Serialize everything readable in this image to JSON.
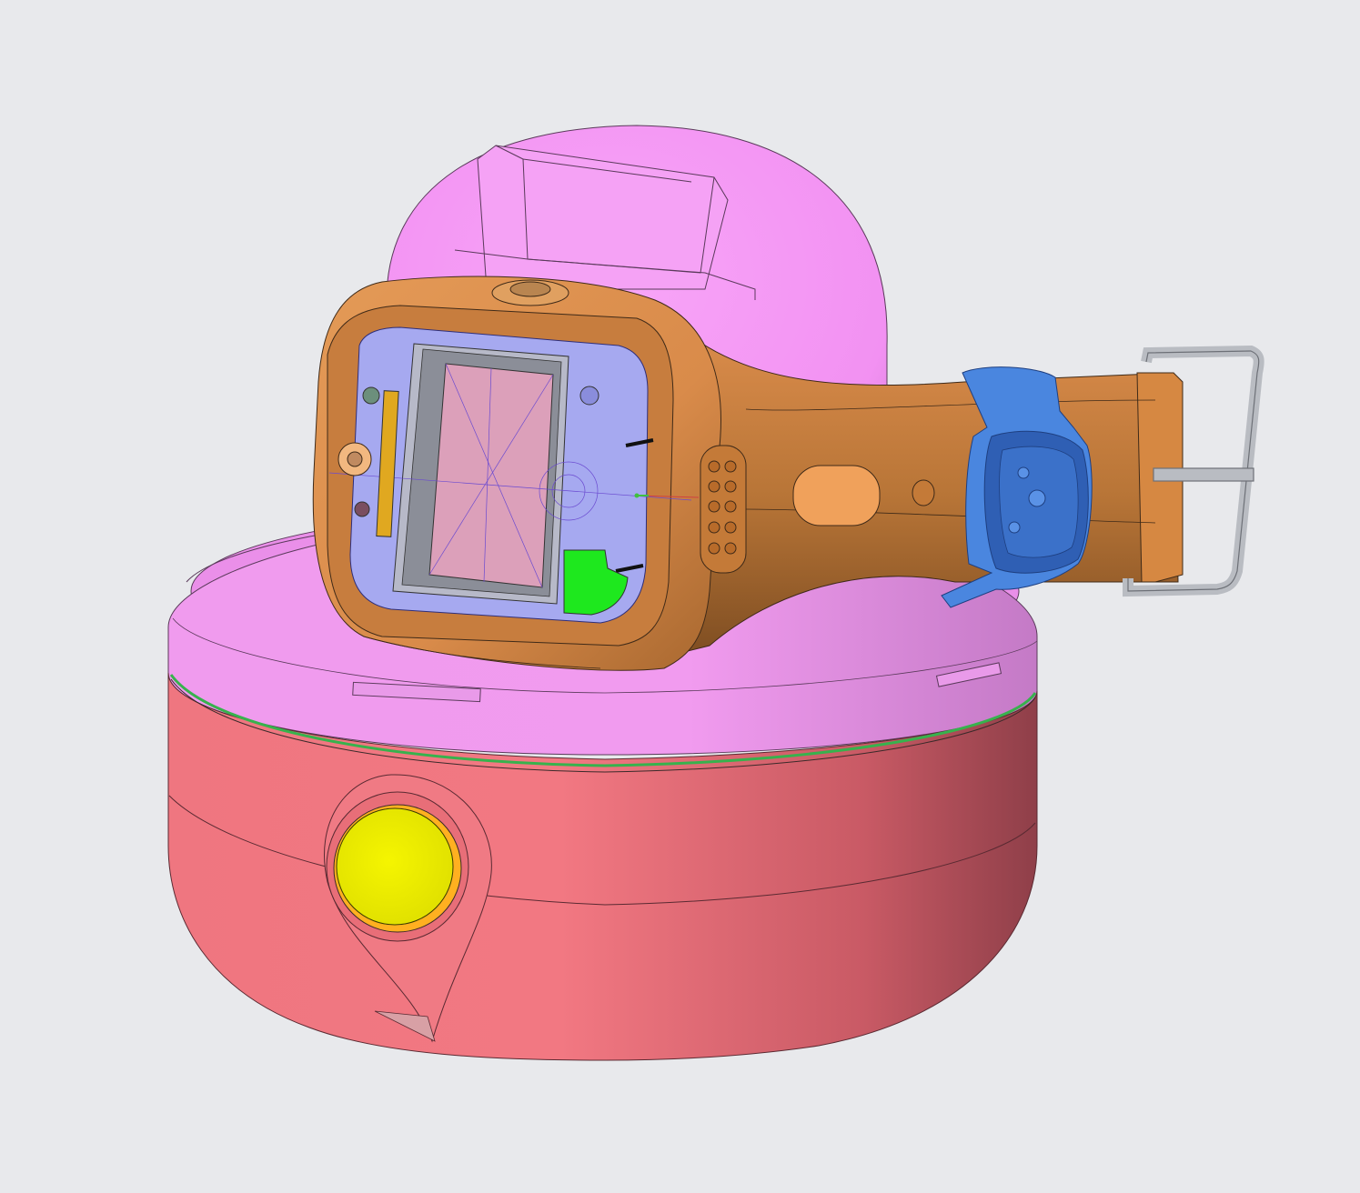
{
  "scene": {
    "background": "#e8e9ec",
    "colors": {
      "dome": "#f59af5",
      "dome_shade": "#d97fda",
      "base_body": "#f27882",
      "base_shade": "#9a4650",
      "base_lid": "#f19bef",
      "accent_line": "#37b24d",
      "button": "#f2f200",
      "watch_case": "#d98b4a",
      "watch_case_dark": "#a2622b",
      "strap": "#c7823f",
      "strap_dark": "#7f4e22",
      "screen_bezel": "#a6a9f0",
      "screen": "#dca0ba",
      "green_patch": "#1ee81e",
      "clip": "#4a86df",
      "clip_dark": "#2f5fb4",
      "buckle": "#b9bcc2"
    },
    "parts": [
      {
        "name": "charging-dome",
        "icon": "dome-shape"
      },
      {
        "name": "charging-base",
        "icon": "cylinder-shape"
      },
      {
        "name": "power-button",
        "icon": "circle-button"
      },
      {
        "name": "smart-watch",
        "icon": "watch"
      },
      {
        "name": "watch-strap",
        "icon": "strap"
      },
      {
        "name": "strap-clip",
        "icon": "clip"
      },
      {
        "name": "buckle",
        "icon": "buckle"
      }
    ]
  }
}
